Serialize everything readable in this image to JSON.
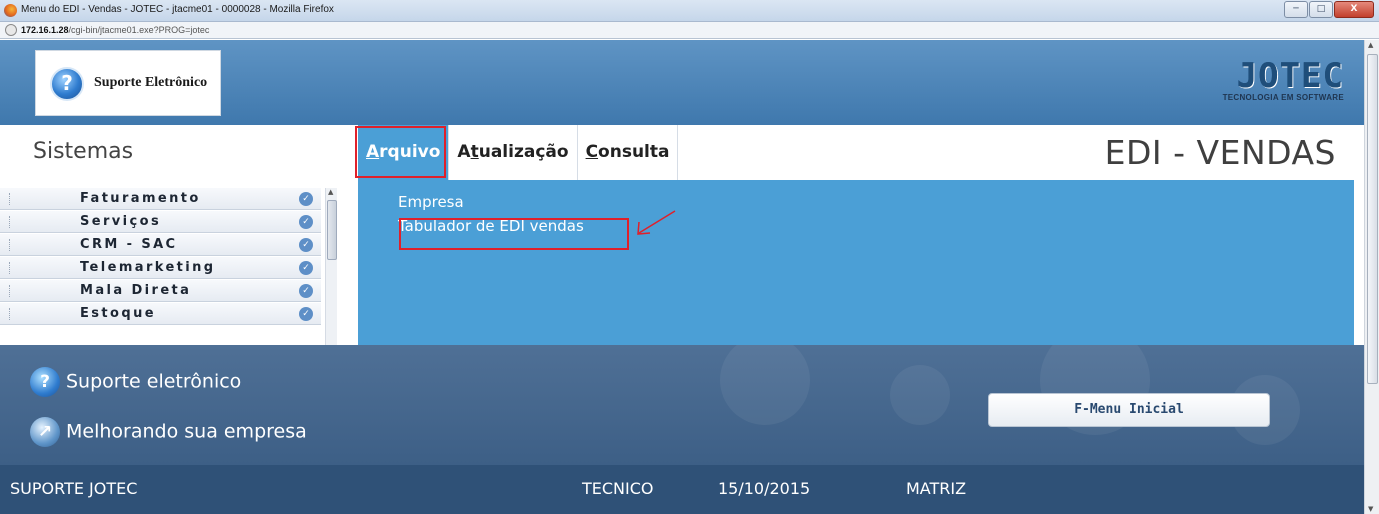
{
  "window": {
    "title": "Menu do EDI - Vendas - JOTEC - jtacme01 - 0000028 - Mozilla Firefox",
    "minimize_label": "─",
    "maximize_label": "□",
    "close_label": "X"
  },
  "address": {
    "host": "172.16.1.28",
    "path": "/cgi-bin/jtacme01.exe?PROG=jotec"
  },
  "header": {
    "support_logo_text": "Suporte Eletrônico",
    "support_logo_glyph": "?",
    "brand": "JOTEC",
    "brand_tagline": "TECNOLOGIA EM SOFTWARE"
  },
  "menubar": {
    "sistemas_title": "Sistemas",
    "items": [
      {
        "ul": "A",
        "rest": "rquivo",
        "active": true
      },
      {
        "pre": "A",
        "ul": "t",
        "rest": "ualização",
        "active": false
      },
      {
        "ul": "C",
        "rest": "onsulta",
        "active": false
      }
    ],
    "page_title": "EDI - VENDAS"
  },
  "sidebar": {
    "items": [
      {
        "label": "Faturamento"
      },
      {
        "label": "Serviços"
      },
      {
        "label": "CRM - SAC"
      },
      {
        "label": "Telemarketing"
      },
      {
        "label": "Mala Direta"
      },
      {
        "label": "Estoque"
      }
    ]
  },
  "submenu": {
    "items": [
      {
        "label": "Empresa"
      },
      {
        "label": "Tabulador de EDI vendas"
      }
    ]
  },
  "footer": {
    "support_text": "Suporte eletrônico",
    "improving_text": "Melhorando sua empresa",
    "fmenu_label": "F-Menu Inicial"
  },
  "status": {
    "user": "SUPORTE JOTEC",
    "role": "TECNICO",
    "date": "15/10/2015",
    "branch": "MATRIZ"
  },
  "colors": {
    "content_blue": "#4b9fd6",
    "header_blue": "#4f88bd",
    "footer_blue": "#3d5f86",
    "status_blue": "#2f5177",
    "highlight_red": "#e0202a"
  }
}
